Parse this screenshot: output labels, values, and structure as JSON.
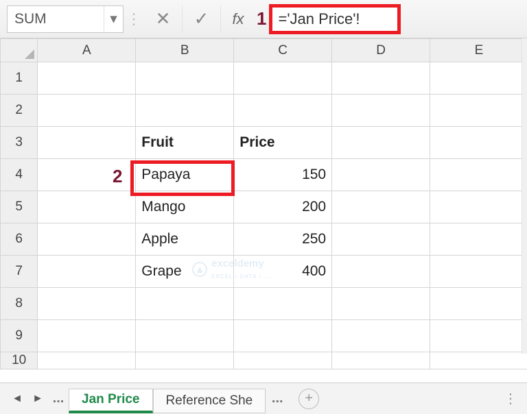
{
  "formula_bar": {
    "name_box": "SUM",
    "cancel_glyph": "✕",
    "enter_glyph": "✓",
    "fx_label": "fx",
    "formula_value": "='Jan Price'!"
  },
  "callouts": {
    "one": "1",
    "two": "2"
  },
  "columns": [
    "A",
    "B",
    "C",
    "D",
    "E"
  ],
  "row_numbers": [
    "1",
    "2",
    "3",
    "4",
    "5",
    "6",
    "7",
    "8",
    "9",
    "10"
  ],
  "cells": {
    "B3": "Fruit",
    "C3": "Price",
    "B4": "Papaya",
    "C4": "150",
    "B5": "Mango",
    "C5": "200",
    "B6": "Apple",
    "C6": "250",
    "B7": "Grape",
    "C7": "400"
  },
  "tabs": {
    "nav_prev": "◄",
    "nav_next": "►",
    "ellipsis": "...",
    "active": "Jan Price",
    "second": "Reference She",
    "ellipsis2": "...",
    "add": "+"
  },
  "watermark": {
    "text": "exceldemy",
    "sub": "EXCEL • DATA • ..."
  }
}
